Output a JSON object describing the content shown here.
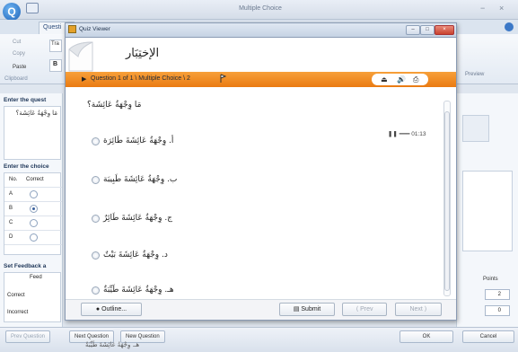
{
  "app": {
    "title": "Multiple Choice",
    "logo_letter": "Q",
    "tab_question": "Questi",
    "ribbon": {
      "cut": "Cut",
      "copy": "Copy",
      "paste": "Paste",
      "clipboard": "Clipboard",
      "tra": "Tra",
      "b": "B",
      "preview": "Preview"
    },
    "left": {
      "enter_question": "Enter the quest",
      "question_text": "مَا وِجْهَةُ عَائِشَة؟",
      "enter_choices": "Enter the choice",
      "no_header": "No.",
      "correct_header": "Correct",
      "rows": [
        "A",
        "B",
        "C",
        "D"
      ],
      "feedback_label": "Set Feedback a",
      "feedback_col": "Feed",
      "correct": "Correct",
      "incorrect": "Incorrect"
    },
    "right": {
      "points_label": "Points",
      "points_1": "2",
      "points_2": "0"
    },
    "bottom": {
      "prev_question": "Prev Question",
      "next_question": "Next Question",
      "new_question": "New Question",
      "ok": "OK",
      "cancel": "Cancel",
      "peek": "هـ. وِجْهَةُ عَائِشَةَ طَيِّبَةٌ"
    }
  },
  "viewer": {
    "title": "Quiz Viewer",
    "heading": "الإختِبَار",
    "counter": "Question 1 of 1 \\ Multiple Choice \\ 2",
    "question": "مَا وِجْهَةُ عَائِشَة؟",
    "timer": "01:13",
    "choices": [
      {
        "text": "أ. وِجْهَةُ عَائِشَةَ طَائِرَة"
      },
      {
        "text": "ب. وِجْهَةُ عَائِشَةَ طَبِيبَة"
      },
      {
        "text": "ج. وِجْهَةُ عَائِشَةَ طَائِرٌ"
      },
      {
        "text": "د. وِجْهَةُ عَائِشَةَ بَيْتٌ"
      },
      {
        "text": "هـ. وِجْهَةُ عَائِشَةَ طَيِّبَةٌ"
      }
    ],
    "footer": {
      "outline": "Outline...",
      "submit": "Submit",
      "prev": "⟨ Prev",
      "next": "Next ⟩"
    }
  }
}
